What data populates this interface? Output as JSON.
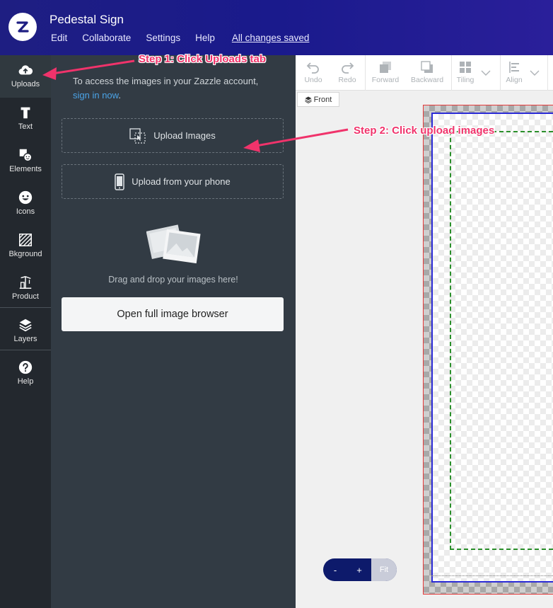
{
  "header": {
    "title": "Pedestal Sign",
    "menu": [
      "Edit",
      "Collaborate",
      "Settings",
      "Help"
    ],
    "saved_status": "All changes saved"
  },
  "rail": {
    "items": [
      {
        "label": "Uploads",
        "icon": "cloud-upload-icon",
        "active": true
      },
      {
        "label": "Text",
        "icon": "text-icon"
      },
      {
        "label": "Elements",
        "icon": "elements-icon"
      },
      {
        "label": "Icons",
        "icon": "smiley-icon"
      },
      {
        "label": "Bkground",
        "icon": "background-pattern-icon"
      },
      {
        "label": "Product",
        "icon": "product-icon"
      },
      {
        "label": "Layers",
        "icon": "layers-icon"
      },
      {
        "label": "Help",
        "icon": "help-icon"
      }
    ]
  },
  "panel": {
    "access_text": "To access the images in your Zazzle account,",
    "sign_in_link": "sign in now",
    "sign_in_suffix": ".",
    "upload_images": "Upload Images",
    "upload_phone": "Upload from your phone",
    "drop_text": "Drag and drop your images here!",
    "open_browser": "Open full image browser"
  },
  "toolbar": {
    "undo": "Undo",
    "redo": "Redo",
    "forward": "Forward",
    "backward": "Backward",
    "tiling": "Tiling",
    "align": "Align"
  },
  "canvas": {
    "side_tab": "Front"
  },
  "zoom": {
    "minus": "-",
    "plus": "+",
    "fit": "Fit"
  },
  "annotations": {
    "step1": "Step 1: Click Uploads tab",
    "step2": "Step 2: Click upload images"
  },
  "colors": {
    "header": "#1e1e82",
    "rail": "#23282e",
    "panel": "#323b44",
    "annotation": "#f0336b",
    "link": "#4ba3e6"
  }
}
